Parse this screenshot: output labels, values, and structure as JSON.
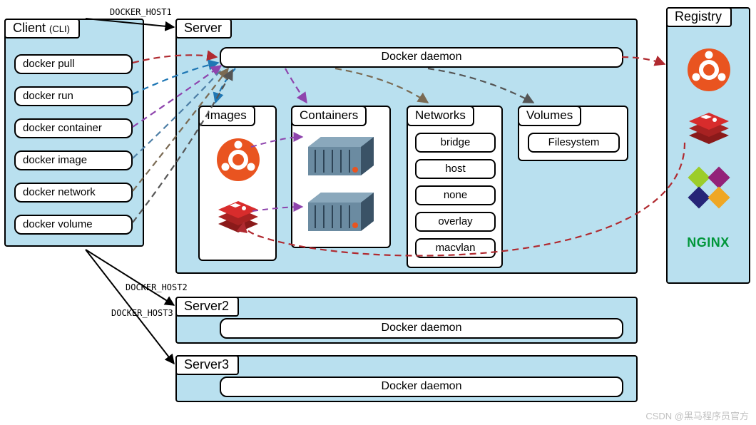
{
  "client": {
    "title": "Client",
    "subtitle": "(CLI)",
    "commands": [
      "docker pull",
      "docker run",
      "docker container",
      "docker image",
      "docker network",
      "docker volume"
    ]
  },
  "hosts": {
    "h1": "DOCKER_HOST1",
    "h2": "DOCKER_HOST2",
    "h3": "DOCKER_HOST3"
  },
  "server1": {
    "title": "Server",
    "daemon": "Docker daemon",
    "images": {
      "title": "Images"
    },
    "containers": {
      "title": "Containers"
    },
    "networks": {
      "title": "Networks",
      "items": [
        "bridge",
        "host",
        "none",
        "overlay",
        "macvlan"
      ]
    },
    "volumes": {
      "title": "Volumes",
      "items": [
        "Filesystem"
      ]
    }
  },
  "server2": {
    "title": "Server2",
    "daemon": "Docker daemon"
  },
  "server3": {
    "title": "Server3",
    "daemon": "Docker daemon"
  },
  "registry": {
    "title": "Registry",
    "nginx": "NGINX"
  },
  "watermark": "CSDN @黑马程序员官方",
  "colors": {
    "panel_fill": "#b9e0ef",
    "ubuntu": "#e95420",
    "redis": "#d82c2c",
    "centos_purple": "#932279",
    "centos_orange": "#efa724",
    "centos_green": "#9ccd2a",
    "centos_blue": "#262577",
    "nginx": "#009639",
    "dash_registry": "#b02a30",
    "dash_images": "#1f77b4",
    "dash_containers": "#8e44ad",
    "dash_networks": "#7a6a53",
    "dash_volumes": "#555"
  }
}
